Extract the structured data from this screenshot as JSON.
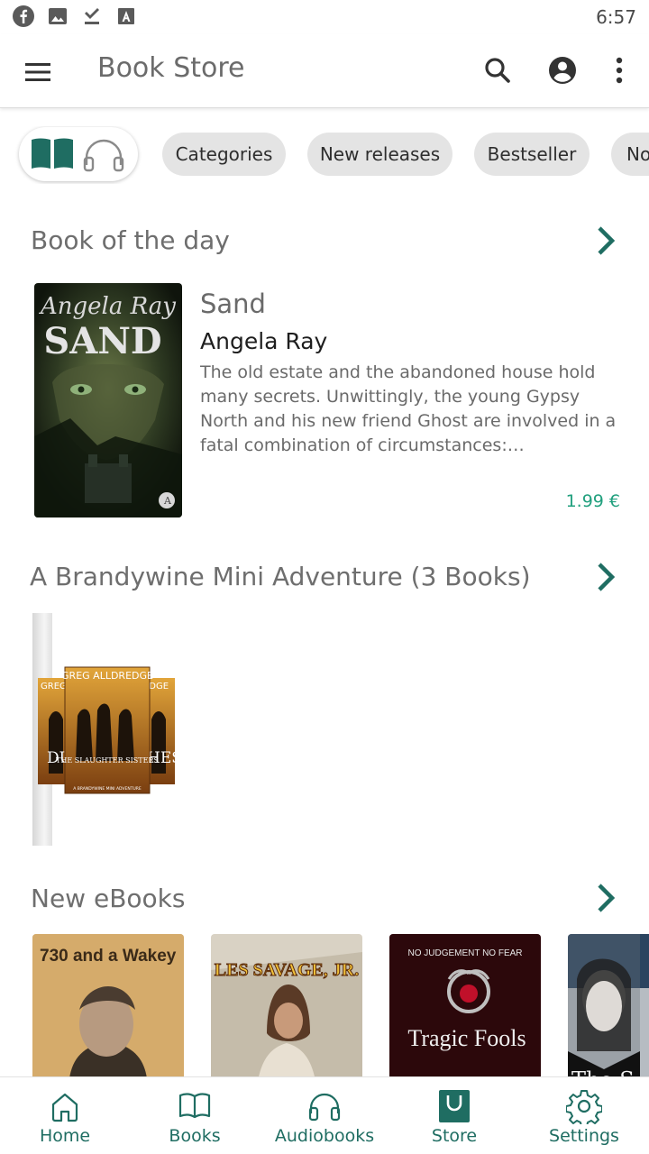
{
  "status_bar": {
    "time": "6:57",
    "icons": [
      "facebook-icon",
      "image-icon",
      "download-done-icon",
      "font-icon"
    ]
  },
  "app_bar": {
    "title": "Book Store",
    "icons": [
      "menu-icon",
      "search-icon",
      "account-icon",
      "more-vert-icon"
    ]
  },
  "filter": {
    "media_toggle": [
      "book-icon",
      "headphones-icon"
    ],
    "chips": [
      "Categories",
      "New releases",
      "Bestseller",
      "No"
    ]
  },
  "sections": {
    "book_of_day": {
      "title": "Book of the day",
      "book": {
        "cover_text_author": "Angela Ray",
        "cover_text_title": "SAND",
        "title": "Sand",
        "author": "Angela Ray",
        "description": "The old estate and the abandoned house hold many secrets. Unwittingly, the young Gypsy North and his new friend Ghost are involved in a fatal combination of circumstances: kidnapping,...",
        "price": "1.99 €"
      }
    },
    "bundle": {
      "title": "A Brandywine Mini Adventure (3 Books)",
      "cover_text_author": "GREG ALLDREDGE",
      "cover_text_title": "THE SLAUGHTER SISTERS",
      "cover_text_subtitle": "A BRANDYWINE MINI ADVENTURE",
      "side_cover_left": "DU TO",
      "side_cover_right": "S HES",
      "side_cover_right_top": "REDGE",
      "side_cover_left_top": "GREG"
    },
    "new_ebooks": {
      "title": "New eBooks",
      "books": [
        {
          "cover_title": "730 and a Wakey"
        },
        {
          "cover_title": "LES SAVAGE, JR."
        },
        {
          "cover_tagline": "NO JUDGEMENT NO FEAR",
          "cover_title": "Tragic Fools"
        },
        {
          "cover_title": "The S"
        }
      ]
    }
  },
  "bottom_nav": {
    "active": "Store",
    "accent": "#1f6d62",
    "items": [
      {
        "label": "Home",
        "icon": "home-icon"
      },
      {
        "label": "Books",
        "icon": "book-open-icon"
      },
      {
        "label": "Audiobooks",
        "icon": "headphones-icon"
      },
      {
        "label": "Store",
        "icon": "shopping-bag-icon"
      },
      {
        "label": "Settings",
        "icon": "gear-icon"
      }
    ]
  },
  "colors": {
    "accent": "#1f6d62",
    "price": "#21a07e",
    "chip_bg": "#e4e4e4"
  }
}
